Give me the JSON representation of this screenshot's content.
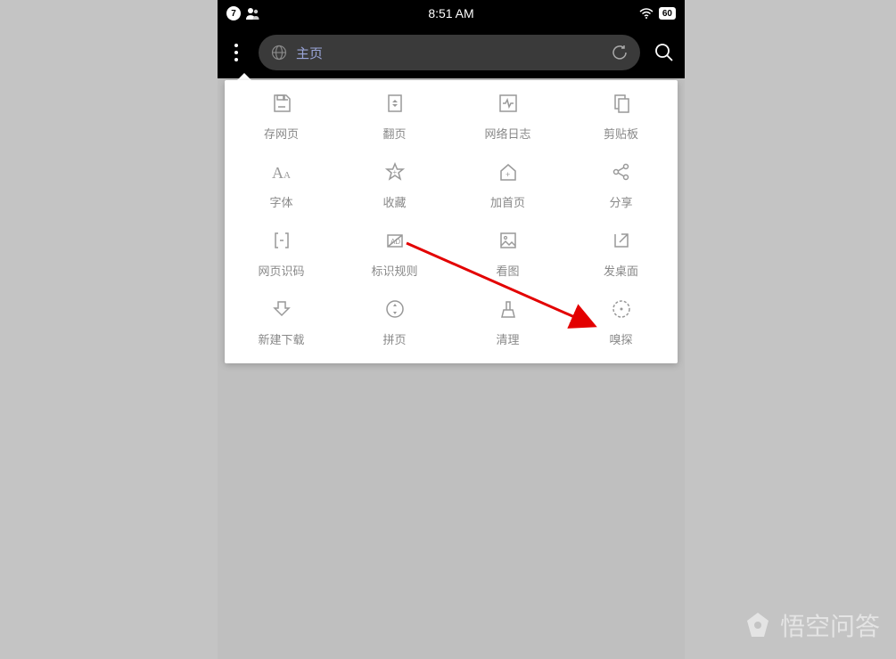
{
  "status": {
    "badge": "7",
    "time": "8:51 AM",
    "battery": "60"
  },
  "nav": {
    "url_text": "主页"
  },
  "menu": {
    "items": [
      {
        "id": "save-page",
        "label": "存网页"
      },
      {
        "id": "flip-page",
        "label": "翻页"
      },
      {
        "id": "net-log",
        "label": "网络日志"
      },
      {
        "id": "clipboard",
        "label": "剪贴板"
      },
      {
        "id": "font",
        "label": "字体"
      },
      {
        "id": "favorites",
        "label": "收藏"
      },
      {
        "id": "add-home",
        "label": "加首页"
      },
      {
        "id": "share",
        "label": "分享"
      },
      {
        "id": "page-code",
        "label": "网页识码"
      },
      {
        "id": "mark-rules",
        "label": "标识规则"
      },
      {
        "id": "view-image",
        "label": "看图"
      },
      {
        "id": "send-desk",
        "label": "发桌面"
      },
      {
        "id": "new-dl",
        "label": "新建下载"
      },
      {
        "id": "merge-page",
        "label": "拼页"
      },
      {
        "id": "cleanup",
        "label": "清理"
      },
      {
        "id": "sniff",
        "label": "嗅探"
      }
    ]
  },
  "watermark": {
    "text": "悟空问答"
  }
}
